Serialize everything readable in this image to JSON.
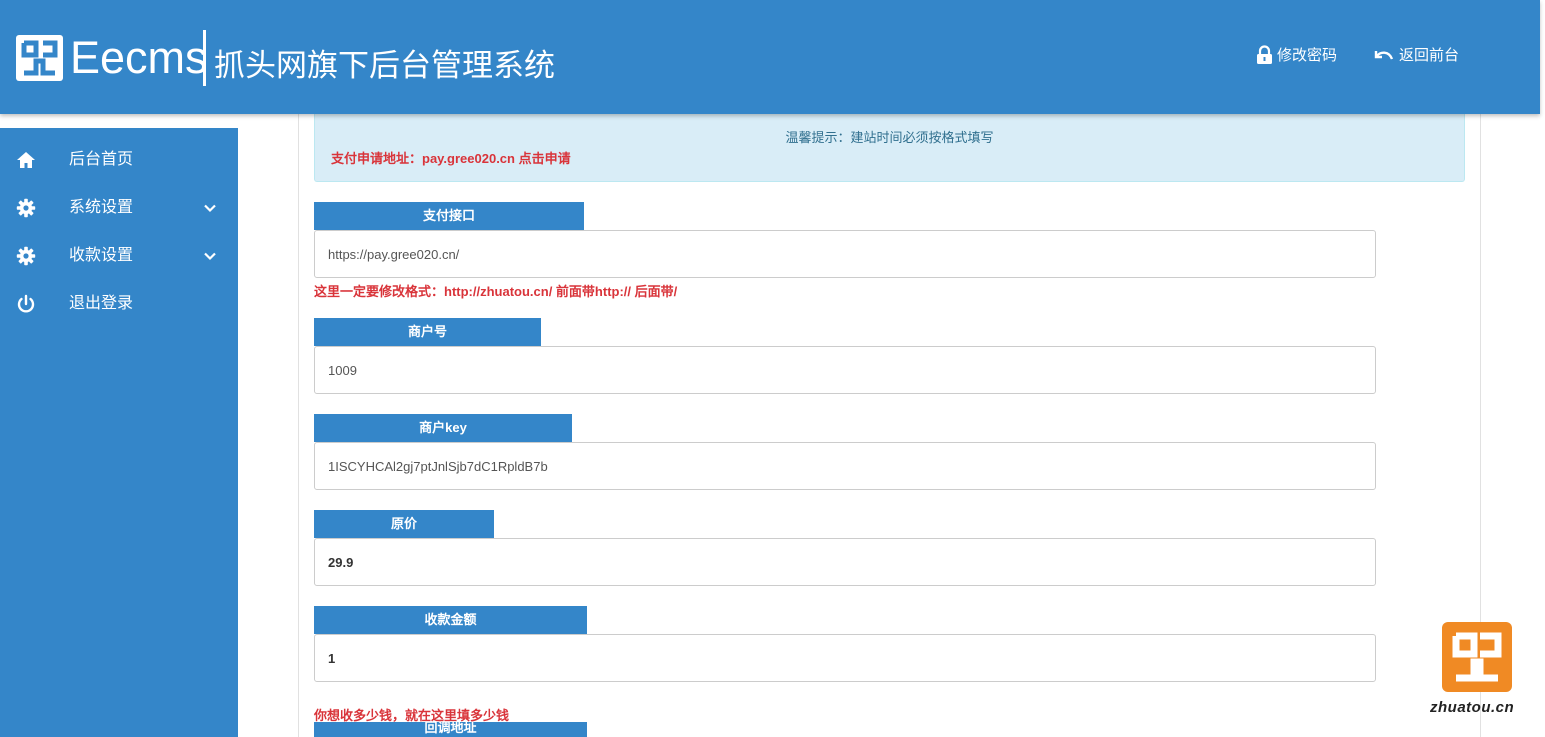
{
  "header": {
    "brand": "Eecms",
    "system_title": "抓头网旗下后台管理系统",
    "change_password": "修改密码",
    "back_to_front": "返回前台"
  },
  "sidebar": {
    "items": [
      {
        "label": "后台首页",
        "icon": "home-icon"
      },
      {
        "label": "系统设置",
        "icon": "gear-icon",
        "expandable": true
      },
      {
        "label": "收款设置",
        "icon": "gear-icon",
        "expandable": true
      },
      {
        "label": "退出登录",
        "icon": "power-icon"
      }
    ]
  },
  "notice": {
    "tip": "温馨提示：建站时间必须按格式填写",
    "apply_link": "支付申请地址：pay.gree020.cn 点击申请"
  },
  "form": {
    "pay_api": {
      "label": "支付接口",
      "value": "https://pay.gree020.cn/",
      "hint": "这里一定要修改格式：http://zhuatou.cn/ 前面带http:// 后面带/"
    },
    "merchant_id": {
      "label": "商户号",
      "value": "1009"
    },
    "merchant_key": {
      "label": "商户key",
      "value": "1ISCYHCAl2gj7ptJnlSjb7dC1RpldB7b"
    },
    "original_price": {
      "label": "原价",
      "value": "29.9"
    },
    "amount": {
      "label": "收款金额",
      "value": "1",
      "hint": "你想收多少钱，就在这里填多少钱"
    },
    "callback_url": {
      "label": "回调地址"
    }
  },
  "watermark": {
    "text": "zhuatou.cn"
  },
  "colors": {
    "primary": "#3486c9",
    "alert": "#d9343a",
    "notice_bg": "#d9edf7",
    "badge": "#f08a24"
  }
}
